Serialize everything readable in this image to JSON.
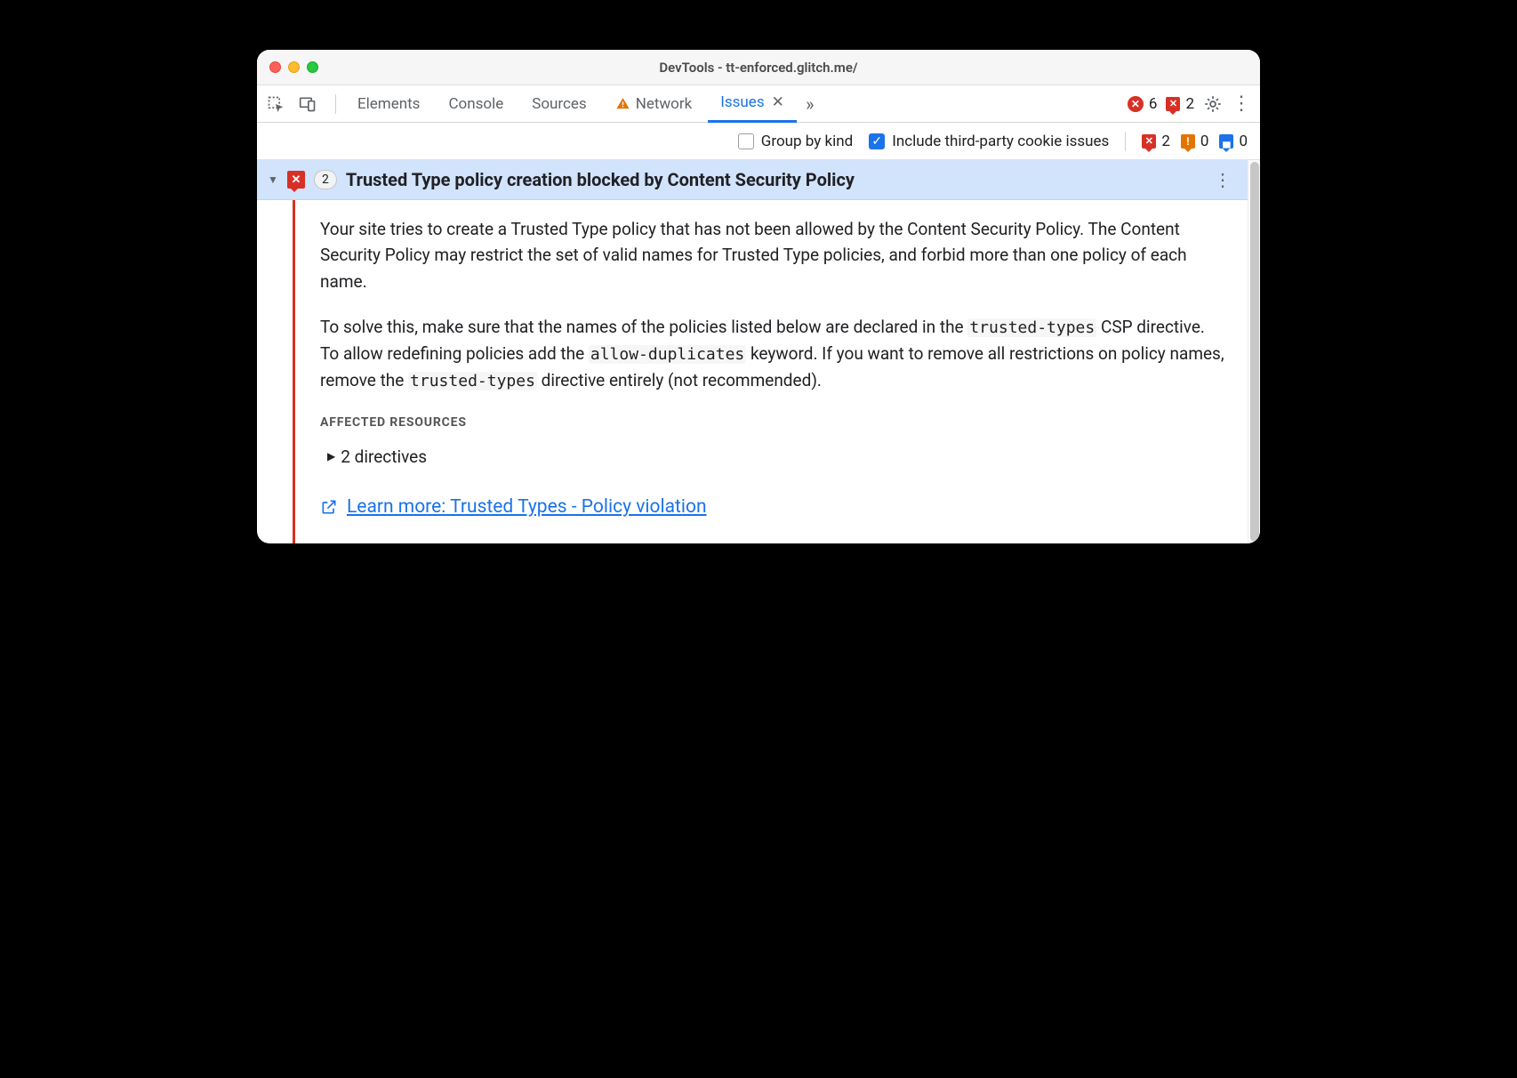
{
  "window": {
    "title": "DevTools - tt-enforced.glitch.me/"
  },
  "tabs": {
    "elements": "Elements",
    "console": "Console",
    "sources": "Sources",
    "network": "Network",
    "issues": "Issues"
  },
  "tabbar_counts": {
    "errors": "6",
    "issue_errors": "2"
  },
  "filter": {
    "group_by_kind": "Group by kind",
    "third_party": "Include third-party cookie issues"
  },
  "filter_counts": {
    "errors": "2",
    "warnings": "0",
    "info": "0"
  },
  "issue": {
    "count": "2",
    "title": "Trusted Type policy creation blocked by Content Security Policy",
    "p1": "Your site tries to create a Trusted Type policy that has not been allowed by the Content Security Policy. The Content Security Policy may restrict the set of valid names for Trusted Type policies, and forbid more than one policy of each name.",
    "p2a": "To solve this, make sure that the names of the policies listed below are declared in the ",
    "p2_code1": "trusted-types",
    "p2b": " CSP directive. To allow redefining policies add the ",
    "p2_code2": "allow-duplicates",
    "p2c": " keyword. If you want to remove all restrictions on policy names, remove the ",
    "p2_code3": "trusted-types",
    "p2d": " directive entirely (not recommended).",
    "affected_label": "AFFECTED RESOURCES",
    "directives": "2 directives",
    "learn_more": "Learn more: Trusted Types - Policy violation"
  }
}
